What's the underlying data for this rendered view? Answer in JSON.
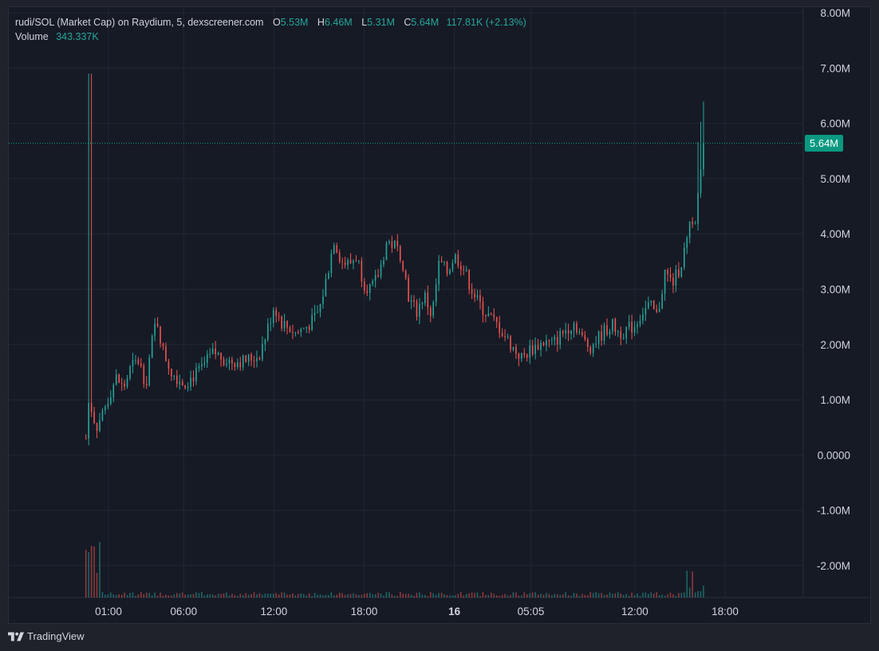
{
  "legend": {
    "title": "rudi/SOL (Market Cap) on Raydium, 5, dexscreener.com",
    "o_label": "O",
    "o_value": "5.53M",
    "h_label": "H",
    "h_value": "6.46M",
    "l_label": "L",
    "l_value": "5.31M",
    "c_label": "C",
    "c_value": "5.64M",
    "change": "117.81K (+2.13%)",
    "volume_label": "Volume",
    "volume_value": "343.337K"
  },
  "price_tag": "5.64M",
  "footer": {
    "brand": "TradingView"
  },
  "colors": {
    "up": "#26a69a",
    "down": "#ef5350",
    "grid": "#232733",
    "price_line": "#089981"
  },
  "chart_data": {
    "type": "candlestick",
    "title": "rudi/SOL (Market Cap) on Raydium, 5, dexscreener.com",
    "ylim": [
      -2600000,
      8100000
    ],
    "y_ticks": [
      {
        "value": 8000000,
        "label": "8.00M"
      },
      {
        "value": 7000000,
        "label": "7.00M"
      },
      {
        "value": 6000000,
        "label": "6.00M"
      },
      {
        "value": 5000000,
        "label": "5.00M"
      },
      {
        "value": 4000000,
        "label": "4.00M"
      },
      {
        "value": 3000000,
        "label": "3.00M"
      },
      {
        "value": 2000000,
        "label": "2.00M"
      },
      {
        "value": 1000000,
        "label": "1.00M"
      },
      {
        "value": 0,
        "label": "0.0000"
      },
      {
        "value": -1000000,
        "label": "-1.00M"
      },
      {
        "value": -2000000,
        "label": "-2.00M"
      }
    ],
    "x_ticks": [
      {
        "hour": 1,
        "label": "01:00",
        "bold": false
      },
      {
        "hour": 6,
        "label": "06:00",
        "bold": false
      },
      {
        "hour": 12,
        "label": "12:00",
        "bold": false
      },
      {
        "hour": 18,
        "label": "18:00",
        "bold": false
      },
      {
        "hour": 24,
        "label": "16",
        "bold": true
      },
      {
        "hour": 29.083,
        "label": "05:05",
        "bold": false
      },
      {
        "hour": 36,
        "label": "12:00",
        "bold": false
      },
      {
        "hour": 42,
        "label": "18:00",
        "bold": false
      }
    ],
    "x_range_hours": [
      -4.2,
      46.2
    ],
    "last_price": 5640000,
    "volume": "343.337K",
    "trend": [
      [
        -0.5,
        300000
      ],
      [
        -0.3,
        1000000
      ],
      [
        0.2,
        500000
      ],
      [
        0.8,
        900000
      ],
      [
        1.5,
        1400000
      ],
      [
        2.0,
        1200000
      ],
      [
        2.5,
        1600000
      ],
      [
        3.0,
        1700000
      ],
      [
        3.5,
        1300000
      ],
      [
        3.8,
        1900000
      ],
      [
        4.2,
        2500000
      ],
      [
        4.6,
        1900000
      ],
      [
        5.2,
        1500000
      ],
      [
        6.0,
        1300000
      ],
      [
        7.0,
        1500000
      ],
      [
        8.0,
        1850000
      ],
      [
        9.0,
        1700000
      ],
      [
        10.0,
        1700000
      ],
      [
        11.0,
        1800000
      ],
      [
        11.5,
        2200000
      ],
      [
        12.0,
        2700000
      ],
      [
        12.5,
        2400000
      ],
      [
        13.5,
        2200000
      ],
      [
        14.5,
        2400000
      ],
      [
        15.0,
        2600000
      ],
      [
        15.5,
        3200000
      ],
      [
        16.0,
        3900000
      ],
      [
        16.5,
        3500000
      ],
      [
        17.0,
        3450000
      ],
      [
        17.5,
        3600000
      ],
      [
        18.0,
        3100000
      ],
      [
        18.5,
        3000000
      ],
      [
        19.0,
        3300000
      ],
      [
        19.5,
        3850000
      ],
      [
        20.0,
        3800000
      ],
      [
        20.5,
        3600000
      ],
      [
        21.0,
        2800000
      ],
      [
        21.5,
        2600000
      ],
      [
        22.0,
        2900000
      ],
      [
        22.5,
        2500000
      ],
      [
        23.0,
        3500000
      ],
      [
        23.5,
        3300000
      ],
      [
        24.0,
        3600000
      ],
      [
        24.5,
        3450000
      ],
      [
        25.0,
        3100000
      ],
      [
        25.5,
        2800000
      ],
      [
        26.0,
        2600000
      ],
      [
        27.0,
        2300000
      ],
      [
        28.0,
        1900000
      ],
      [
        28.5,
        1750000
      ],
      [
        29.0,
        1900000
      ],
      [
        30.0,
        2050000
      ],
      [
        30.5,
        2000000
      ],
      [
        31.0,
        2150000
      ],
      [
        31.5,
        2300000
      ],
      [
        32.0,
        2400000
      ],
      [
        32.5,
        2100000
      ],
      [
        33.0,
        1950000
      ],
      [
        33.5,
        2100000
      ],
      [
        34.0,
        2250000
      ],
      [
        34.5,
        2350000
      ],
      [
        35.0,
        2200000
      ],
      [
        36.0,
        2350000
      ],
      [
        36.5,
        2600000
      ],
      [
        37.0,
        2700000
      ],
      [
        37.5,
        2500000
      ],
      [
        38.0,
        3300000
      ],
      [
        38.5,
        3100000
      ],
      [
        39.0,
        3400000
      ],
      [
        39.5,
        3900000
      ],
      [
        39.8,
        4300000
      ],
      [
        40.0,
        4150000
      ],
      [
        40.3,
        5000000
      ],
      [
        40.6,
        5640000
      ]
    ]
  }
}
